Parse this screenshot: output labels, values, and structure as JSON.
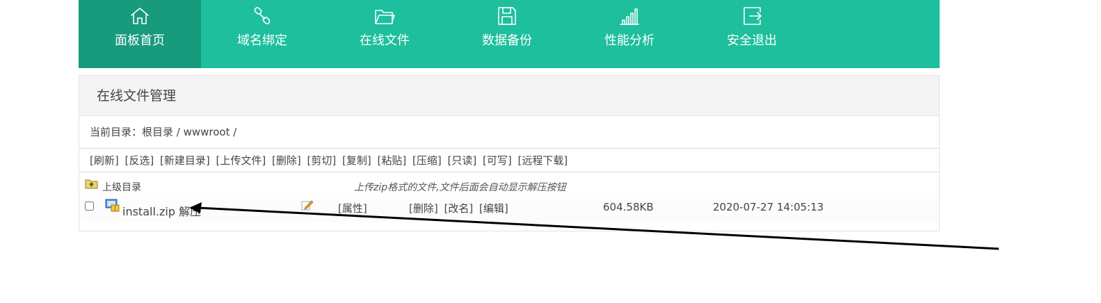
{
  "nav": {
    "items": [
      {
        "label": "面板首页",
        "icon": "home-icon"
      },
      {
        "label": "域名绑定",
        "icon": "link-icon"
      },
      {
        "label": "在线文件",
        "icon": "folder-icon"
      },
      {
        "label": "数据备份",
        "icon": "save-icon"
      },
      {
        "label": "性能分析",
        "icon": "bar-chart-icon"
      },
      {
        "label": "安全退出",
        "icon": "logout-icon"
      }
    ],
    "active_color": "#189a7c",
    "bg_color": "#1dbf9c"
  },
  "panel": {
    "title": "在线文件管理",
    "breadcrumb": "当前目录：根目录 / wwwroot /"
  },
  "toolbar": {
    "buttons": [
      "[刷新]",
      "[反选]",
      "[新建目录]",
      "[上传文件]",
      "[删除]",
      "[剪切]",
      "[复制]",
      "[粘贴]",
      "[压缩]",
      "[只读]",
      "[可写]",
      "[远程下载]"
    ]
  },
  "listing": {
    "parent_label": "上级目录",
    "hint": "上传zip格式的文件,文件后面会自动显示解压按钮",
    "files": [
      {
        "name": "install.zip",
        "extract": "解压",
        "attr": "[属性]",
        "delete": "[删除]",
        "rename": "[改名]",
        "edit": "[编辑]",
        "size": "604.58KB",
        "modified": "2020-07-27 14:05:13"
      }
    ]
  }
}
